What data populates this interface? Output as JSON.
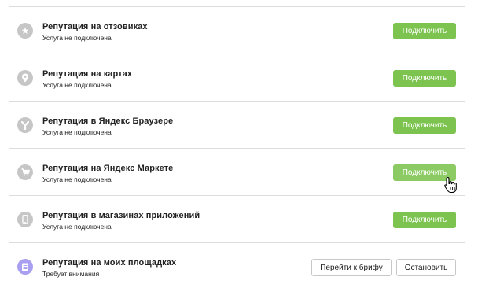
{
  "services": [
    {
      "title": "Репутация на отзовиках",
      "status": "Услуга не подключена",
      "icon": "star-icon",
      "button": "Подключить"
    },
    {
      "title": "Репутация на картах",
      "status": "Услуга не подключена",
      "icon": "map-pin-icon",
      "button": "Подключить"
    },
    {
      "title": "Репутация в Яндекс Браузере",
      "status": "Услуга не подключена",
      "icon": "yandex-browser-icon",
      "button": "Подключить"
    },
    {
      "title": "Репутация на Яндекс Маркете",
      "status": "Услуга не подключена",
      "icon": "cart-icon",
      "button": "Подключить"
    },
    {
      "title": "Репутация в магазинах приложений",
      "status": "Услуга не подключена",
      "icon": "phone-icon",
      "button": "Подключить"
    },
    {
      "title": "Репутация на моих площадках",
      "status": "Требует внимания",
      "icon": "list-icon",
      "primary_button": "Перейти к брифу",
      "secondary_button": "Остановить"
    }
  ],
  "colors": {
    "accent_green": "#7cc34f",
    "icon_grey": "#c6c6c6",
    "attention_purple": "#a99ff0",
    "divider": "#dcdcdc"
  }
}
